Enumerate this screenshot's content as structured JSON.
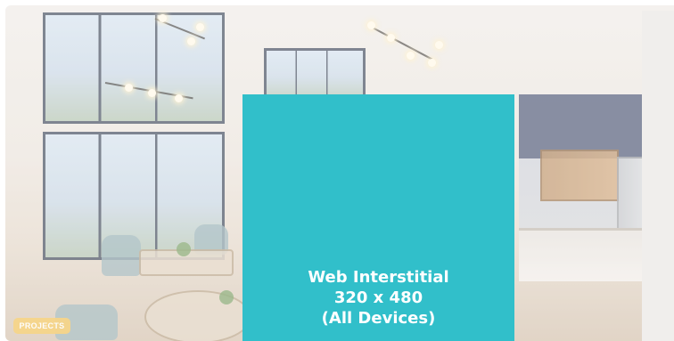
{
  "badge": {
    "label": "PROJECTS",
    "color": "#f6d58a"
  },
  "ad": {
    "line1": "Web Interstitial",
    "line2": "320 x 480",
    "line3": "(All Devices)",
    "background": "#31bfca",
    "text_color": "#ffffff"
  },
  "background_image": {
    "icon": "interior-photo"
  }
}
